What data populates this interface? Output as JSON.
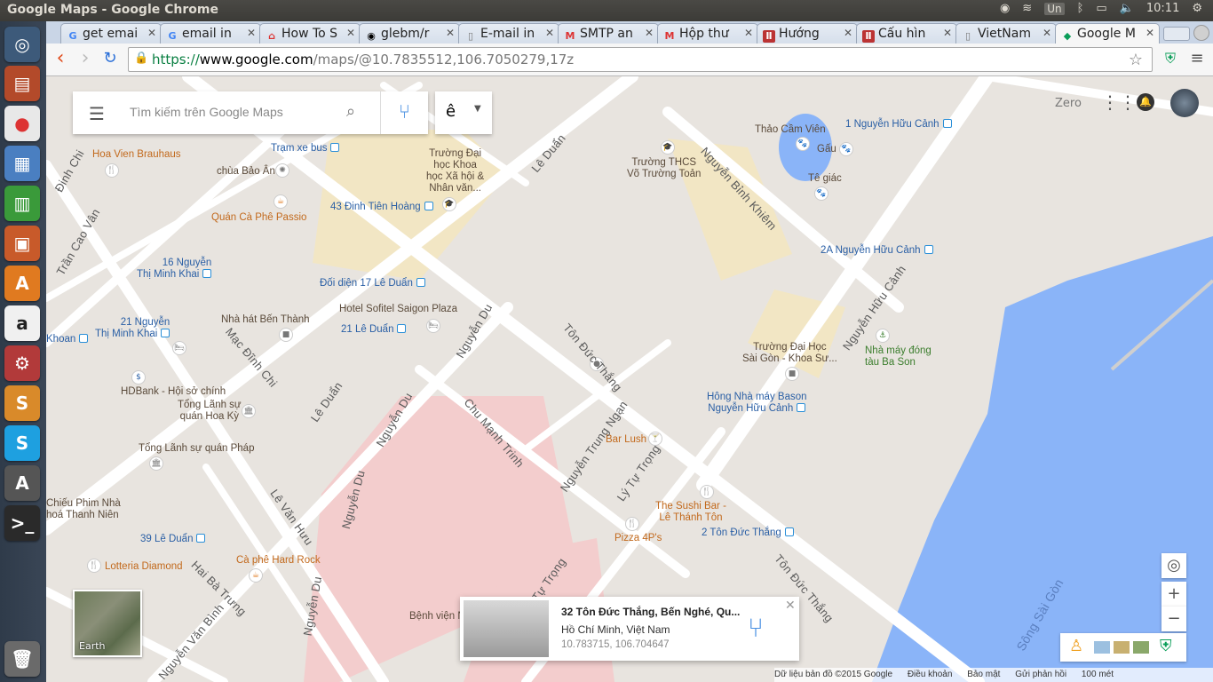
{
  "os": {
    "window_title": "Google Maps - Google Chrome",
    "keyboard": "Un",
    "clock": "10:11"
  },
  "tabs": [
    {
      "label": "get emai",
      "icon": "google-icon"
    },
    {
      "label": "email in",
      "icon": "google-icon"
    },
    {
      "label": "How To S",
      "icon": "howto-icon"
    },
    {
      "label": "glebm/r",
      "icon": "github-icon"
    },
    {
      "label": "E-mail in",
      "icon": "document-icon"
    },
    {
      "label": "SMTP an",
      "icon": "gmail-icon"
    },
    {
      "label": "Hộp thư",
      "icon": "gmail-icon"
    },
    {
      "label": "Hướng",
      "icon": "book-icon"
    },
    {
      "label": "Cấu hìn",
      "icon": "book-icon"
    },
    {
      "label": "VietNam",
      "icon": "document-icon"
    },
    {
      "label": "Google M",
      "icon": "maps-icon"
    }
  ],
  "address_bar": {
    "scheme": "https://",
    "host": "www.google.com",
    "path": "/maps/@10.7835512,106.7050279,17z"
  },
  "search": {
    "placeholder": "Tìm kiếm trên Google Maps",
    "ime_label": "ê"
  },
  "account": {
    "name": "Zero"
  },
  "map_labels": {
    "tram_xe_bus": "Trạm xe bus",
    "hoa_vien": "Hoa Vien Brauhaus",
    "chua_bao_an": "chùa Bảo Ân",
    "quan_ca_phe_passio": "Quán Cà Phê Passio",
    "dh_khxh_1": "Trường Đại",
    "dh_khxh_2": "học Khoa",
    "dh_khxh_3": "học Xã hội &",
    "dh_khxh_4": "Nhân văn...",
    "dinh_tien_hoang": "43 Đinh Tiên Hoàng",
    "thcs_vtt_1": "Trường THCS",
    "thcs_vtt_2": "Võ Trường Toản",
    "thao_cam_vien": "Thảo Cầm Viên",
    "gau": "Gấu",
    "te_giac": "Tê giác",
    "nguyen_huu_canh_1": "1 Nguyễn Hữu Cảnh",
    "nguyen_huu_canh_2a": "2A Nguyễn Hữu Cảnh",
    "nguyen_thi_minh_khai_16a": "16 Nguyễn",
    "nguyen_thi_minh_khai_16b": "Thị Minh Khai",
    "doi_dien_17_le_duan": "Đối diện 17 Lê Duẩn",
    "hotel_sofitel": "Hotel Sofitel Saigon Plaza",
    "le_duan_21": "21 Lê Duẩn",
    "nha_hat_ben_thanh": "Nhà hát Bến Thành",
    "nguyen_thi_minh_khai_21a": "21 Nguyễn",
    "nguyen_thi_minh_khai_21b": "Thị Minh Khai",
    "khoan": "Khoan",
    "hdbank": "HDBank - Hội sở chính",
    "tong_lanh_su_hoa_ky_1": "Tổng Lãnh sự",
    "tong_lanh_su_hoa_ky_2": "quán Hoa Kỳ",
    "tong_lanh_su_phap": "Tổng Lãnh sự quán Pháp",
    "dh_saigon_1": "Trường Đại Học",
    "dh_saigon_2": "Sài Gòn - Khoa Sư...",
    "bason_1": "Hông Nhà máy Bason",
    "bason_2": "Nguyễn Hữu Cảnh",
    "nha_may_ba_son_1": "Nhà máy đóng",
    "nha_may_ba_son_2": "tàu Ba Son",
    "bar_lush": "Bar Lush",
    "sushi_bar_1": "The Sushi Bar -",
    "sushi_bar_2": "Lê Thánh Tôn",
    "pizza_4ps": "Pizza 4P's",
    "ton_duc_thang_2": "2 Tôn Đức Thắng",
    "chieu_phim_1": "Chiếu Phim Nhà",
    "chieu_phim_2": "hoá Thanh Niên",
    "le_duan_39": "39 Lê Duẩn",
    "lotteria": "Lotteria Diamond",
    "ca_phe_hard_rock": "Cà phê Hard Rock",
    "benh_vien": "Bệnh viện N..."
  },
  "streets": {
    "le_duan": "Lê Duẩn",
    "nguyen_binh_khiem": "Nguyễn Bỉnh Khiêm",
    "nguyen_huu_canh": "Nguyễn Hữu Cảnh",
    "ton_duc_thang": "Tôn Đức Thắng",
    "nguyen_du": "Nguyễn Du",
    "mac_dinh_chi": "Mạc Đĩnh Chi",
    "chu_manh_trinh": "Chu Mạnh Trinh",
    "nguyen_trung_ngan": "Nguyễn Trung Ngạn",
    "ly_tu_trong": "Lý Tự Trọng",
    "le_van_huu": "Lê Văn Hưu",
    "hai_ba_trung": "Hai Bà Trưng",
    "nguyen_van_binh": "Nguyễn Văn Bình",
    "tu_trong": "Tự Trọng",
    "dinh_chi": "Đinh Chi",
    "tran_cao_van": "Trần Cao Vân",
    "song_sai_gon": "Sông Sài Gòn",
    "thi_label": "Thị"
  },
  "earth_toggle": "Earth",
  "place_card": {
    "title": "32 Tôn Đức Thắng, Bến Nghé, Qu...",
    "city": "Hồ Chí Minh, Việt Nam",
    "coords": "10.783715, 106.704647"
  },
  "footer": {
    "copyright": "Dữ liệu bản đồ ©2015 Google",
    "terms": "Điều khoản",
    "privacy": "Bảo mật",
    "feedback": "Gửi phản hồi",
    "scale": "100 mét"
  },
  "colors": {
    "map_bg": "#e8e4df",
    "road": "#ffffff",
    "water": "#8ab4f8",
    "pink_block": "#f0c4c4",
    "beige_block": "#f2e4c0",
    "accent_blue": "#4a90e2"
  }
}
